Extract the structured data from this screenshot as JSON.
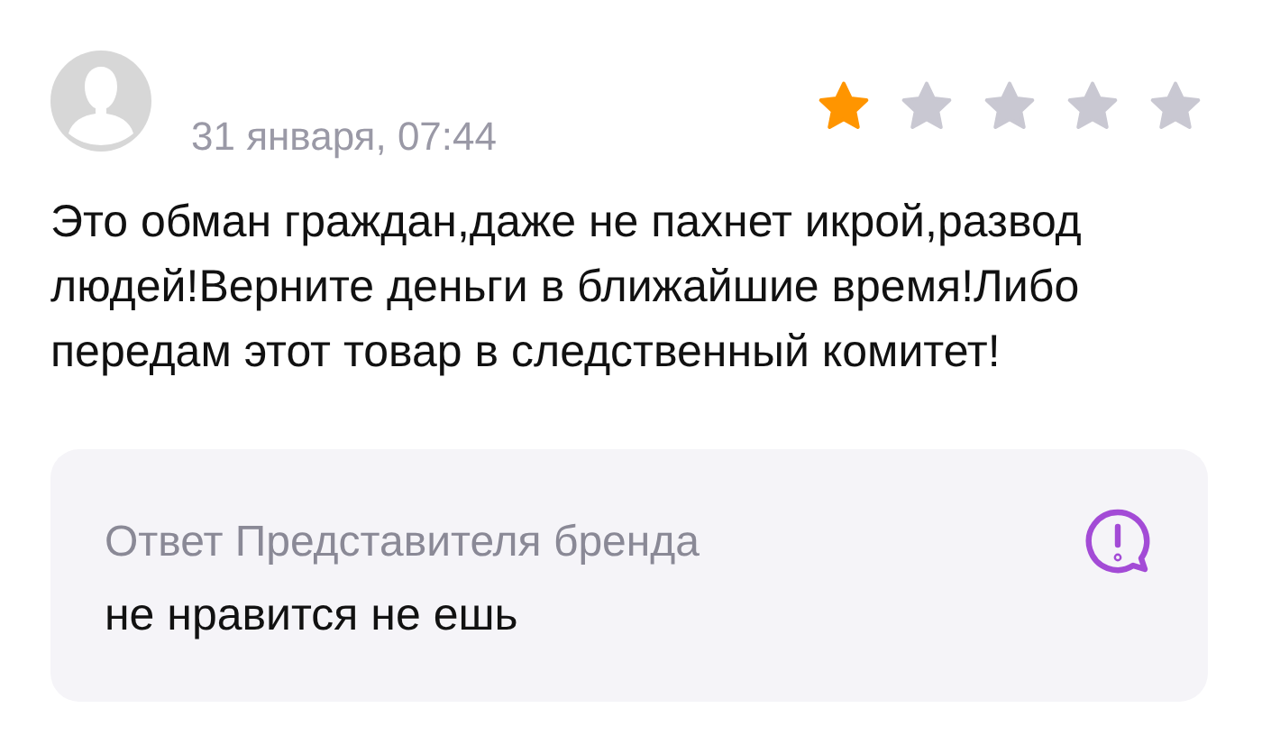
{
  "review": {
    "date": "31 января, 07:44",
    "stars": 1,
    "text": "Это обман граждан,даже не пахнет икрой,развод людей!Верните деньги в ближайшие время!Либо передам этот товар в следственный комитет!"
  },
  "reply": {
    "title": "Ответ Представителя бренда",
    "text": "не нравится не ешь"
  }
}
